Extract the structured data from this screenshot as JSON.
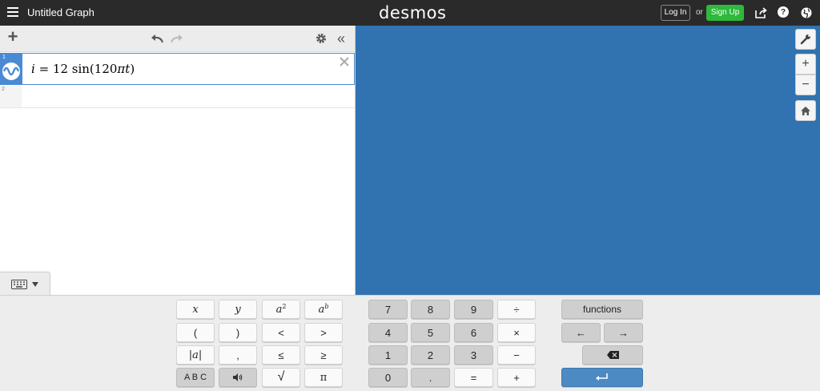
{
  "header": {
    "title": "Untitled Graph",
    "logo": "desmos",
    "login_label": "Log In",
    "or_label": "or",
    "signup_label": "Sign Up",
    "help_label": "?"
  },
  "toolbar": {
    "add_label": "+",
    "collapse_label": "«"
  },
  "expressions": [
    {
      "number": "1",
      "lhs": "i",
      "eq": " = 12 sin(120",
      "pi": "π",
      "var": "t",
      "close": ")"
    },
    {
      "number": "2"
    }
  ],
  "graph_controls": {
    "zoom_in": "+",
    "zoom_out": "−"
  },
  "keypad": {
    "alpha_keys": [
      "x",
      "y"
    ],
    "a2_base": "a",
    "a2_exp": "2",
    "ab_base": "a",
    "ab_exp": "b",
    "row2": [
      "(",
      ")",
      "<",
      ">"
    ],
    "abs": "|a|",
    "comma": ",",
    "le": "≤",
    "ge": "≥",
    "abc": "A B C",
    "sqrt": "√",
    "pi": "π",
    "nums_row1": [
      "7",
      "8",
      "9",
      "÷"
    ],
    "nums_row2": [
      "4",
      "5",
      "6",
      "×"
    ],
    "nums_row3": [
      "1",
      "2",
      "3",
      "−"
    ],
    "nums_row4": [
      "0",
      ".",
      "=",
      "+"
    ],
    "functions_label": "functions",
    "left_arrow": "←",
    "right_arrow": "→"
  },
  "colors": {
    "header_bg": "#2a2a2a",
    "graph_bg": "#3173b0",
    "accent": "#4a8ad4",
    "signup_green": "#2eb83c",
    "enter_blue": "#4c8ac4"
  }
}
